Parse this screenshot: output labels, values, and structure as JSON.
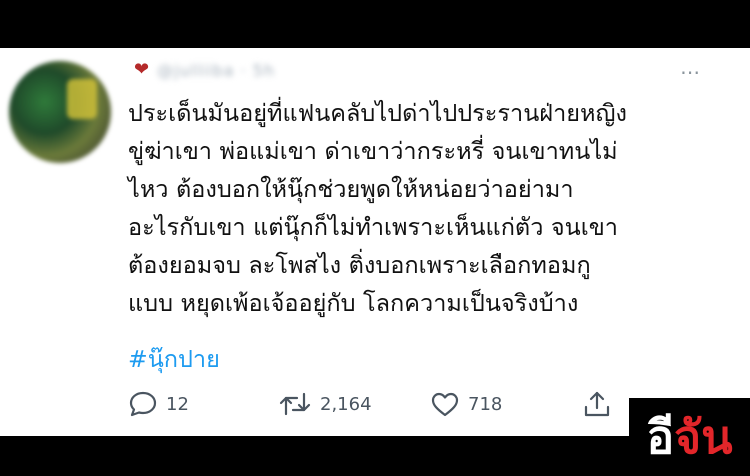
{
  "tweet": {
    "body": "ประเด็นมันอยู่ที่แฟนคลับไปด่าไปประรานฝ่ายหญิง\nขู่ฆ่าเขา พ่อแม่เขา ด่าเขาว่ากระหรี่ จนเขาทนไม่\nไหว ต้องบอกให้นุ๊กช่วยพูดให้หน่อยว่าอย่ามา\nอะไรกับเขา แต่นุ๊กก็ไม่ทำเพราะเห็นแก่ตัว จนเขา\nต้องยอมจบ ละโพสไง ติ่งบอกเพราะเลือกทอมกู\nแบบ หยุดเพ้อเจ้ออยู่กับ โลกความเป็นจริงบ้าง",
    "hashtag": "#นุ๊กปาย"
  },
  "header": {
    "heart_emoji": "❤",
    "handle": "@julliiba · 5h",
    "more_icon": "⋯"
  },
  "actions": {
    "replies": "12",
    "retweets": "2,164",
    "likes": "718"
  },
  "watermark": {
    "logo_first": "อี",
    "logo_second": "จัน"
  },
  "colors": {
    "hashtag": "#1d9bf0",
    "icon": "#4a5560",
    "logo_red": "#e3262a"
  }
}
